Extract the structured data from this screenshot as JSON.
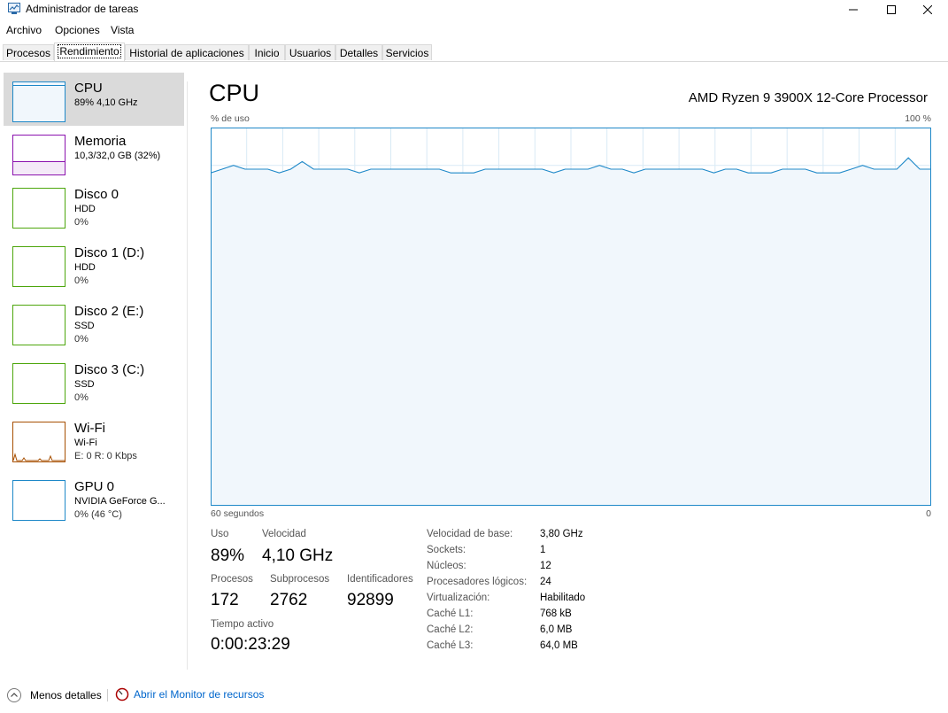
{
  "window": {
    "title": "Administrador de tareas"
  },
  "menu": [
    "Archivo",
    "Opciones",
    "Vista"
  ],
  "tabs": [
    "Procesos",
    "Rendimiento",
    "Historial de aplicaciones",
    "Inicio",
    "Usuarios",
    "Detalles",
    "Servicios"
  ],
  "colors": {
    "cpu": "#1e88c8",
    "memory": "#8b12ae",
    "disk": "#4da60c",
    "wifi": "#a74f01",
    "gpu": "#1e88c8"
  },
  "sidebar": [
    {
      "name": "CPU",
      "line2": "89% 4,10 GHz",
      "line3": ""
    },
    {
      "name": "Memoria",
      "line2": "10,3/32,0 GB (32%)",
      "line3": ""
    },
    {
      "name": "Disco 0",
      "line2": "HDD",
      "line3": "0%"
    },
    {
      "name": "Disco 1 (D:)",
      "line2": "HDD",
      "line3": "0%"
    },
    {
      "name": "Disco 2 (E:)",
      "line2": "SSD",
      "line3": "0%"
    },
    {
      "name": "Disco 3 (C:)",
      "line2": "SSD",
      "line3": "0%"
    },
    {
      "name": "Wi-Fi",
      "line2": "Wi-Fi",
      "line3": "E: 0 R: 0 Kbps"
    },
    {
      "name": "GPU 0",
      "line2": "NVIDIA GeForce G...",
      "line3": "0% (46 °C)"
    }
  ],
  "main": {
    "title": "CPU",
    "processor": "AMD Ryzen 9 3900X 12-Core Processor",
    "usage_label": "% de uso",
    "max_label": "100 %",
    "time_label": "60 segundos",
    "zero_label": "0"
  },
  "chart_data": {
    "type": "area",
    "x_label": "60 segundos",
    "y_label": "% de uso",
    "ylim": [
      0,
      100
    ],
    "grid": true,
    "values": [
      88,
      89,
      90,
      89,
      89,
      89,
      88,
      89,
      91,
      89,
      89,
      89,
      89,
      88,
      89,
      89,
      89,
      89,
      89,
      89,
      89,
      88,
      88,
      88,
      89,
      89,
      89,
      89,
      89,
      89,
      88,
      89,
      89,
      89,
      90,
      89,
      89,
      88,
      89,
      89,
      89,
      89,
      89,
      89,
      88,
      89,
      89,
      88,
      88,
      88,
      89,
      89,
      89,
      88,
      88,
      88,
      89,
      90,
      89,
      89,
      89,
      92,
      89,
      89
    ]
  },
  "stats": {
    "uso": {
      "label": "Uso",
      "value": "89%"
    },
    "velocidad": {
      "label": "Velocidad",
      "value": "4,10 GHz"
    },
    "procesos": {
      "label": "Procesos",
      "value": "172"
    },
    "subprocesos": {
      "label": "Subprocesos",
      "value": "2762"
    },
    "identificadores": {
      "label": "Identificadores",
      "value": "92899"
    },
    "tiempo": {
      "label": "Tiempo activo",
      "value": "0:00:23:29"
    }
  },
  "details": [
    {
      "label": "Velocidad de base:",
      "value": "3,80 GHz"
    },
    {
      "label": "Sockets:",
      "value": "1"
    },
    {
      "label": "Núcleos:",
      "value": "12"
    },
    {
      "label": "Procesadores lógicos:",
      "value": "24"
    },
    {
      "label": "Virtualización:",
      "value": "Habilitado"
    },
    {
      "label": "Caché L1:",
      "value": "768 kB"
    },
    {
      "label": "Caché L2:",
      "value": "6,0 MB"
    },
    {
      "label": "Caché L3:",
      "value": "64,0 MB"
    }
  ],
  "footer": {
    "less_details": "Menos detalles",
    "resource_monitor": "Abrir el Monitor de recursos"
  }
}
